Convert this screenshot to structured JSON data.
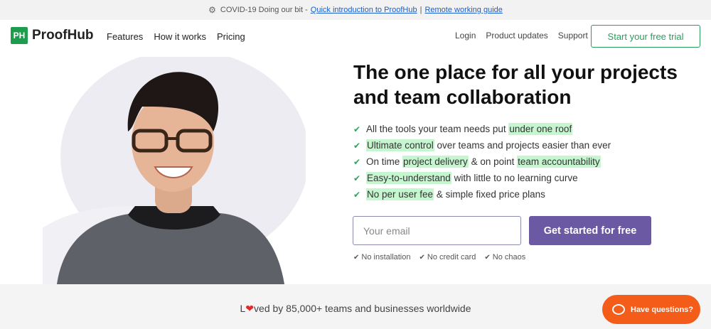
{
  "topbar": {
    "gear_icon": "gear-icon",
    "text": "COVID-19 Doing our bit -",
    "link1": "Quick introduction to ProofHub",
    "separator": "|",
    "link2": "Remote working guide"
  },
  "nav": {
    "logo_mark": "PH",
    "logo_text": "ProofHub",
    "left_items": [
      "Features",
      "How it works",
      "Pricing"
    ],
    "right_items": [
      "Login",
      "Product updates",
      "Support"
    ],
    "trial_button": "Start your free trial"
  },
  "hero": {
    "title": "The one place for all your projects and team collaboration",
    "features": [
      {
        "pre": "All the tools your team needs put ",
        "hl": "under one roof",
        "post": ""
      },
      {
        "pre": "",
        "hl": "Ultimate control",
        "post": " over teams and projects easier than ever"
      },
      {
        "pre": "On time ",
        "hl": "project delivery",
        "post": " & on point ",
        "hl2": "team accountability"
      },
      {
        "pre": "",
        "hl": "Easy-to-understand",
        "post": " with little to no learning curve"
      },
      {
        "pre": "",
        "hl": "No per user fee",
        "post": " & simple fixed price plans"
      }
    ],
    "email_placeholder": "Your email",
    "cta": "Get started for free",
    "perks": [
      "No installation",
      "No credit card",
      "No chaos"
    ]
  },
  "social_proof": {
    "pre": "L",
    "post": "ved by 85,000+ teams and businesses worldwide"
  },
  "chat": {
    "label": "Have questions?"
  },
  "colors": {
    "brand_green": "#1f9b4d",
    "cta_purple": "#6b5aa3",
    "chat_orange": "#f45c1a",
    "highlight": "#c6f6cf"
  }
}
